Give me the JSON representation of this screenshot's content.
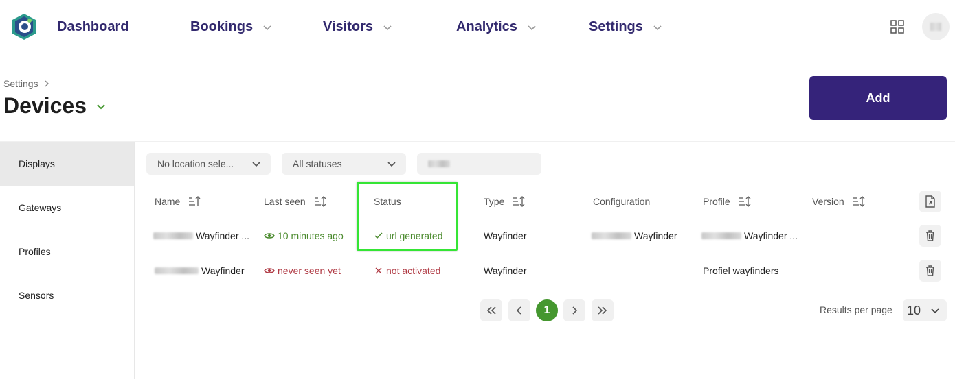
{
  "nav": {
    "dashboard": "Dashboard",
    "bookings": "Bookings",
    "visitors": "Visitors",
    "analytics": "Analytics",
    "settings": "Settings"
  },
  "header": {
    "breadcrumb": "Settings",
    "title": "Devices",
    "add_label": "Add"
  },
  "sidebar": {
    "items": [
      {
        "label": "Displays",
        "active": true
      },
      {
        "label": "Gateways"
      },
      {
        "label": "Profiles"
      },
      {
        "label": "Sensors"
      }
    ]
  },
  "filters": {
    "location": "No location sele...",
    "status": "All statuses"
  },
  "table": {
    "headers": {
      "name": "Name",
      "last_seen": "Last seen",
      "status": "Status",
      "type": "Type",
      "configuration": "Configuration",
      "profile": "Profile",
      "version": "Version"
    },
    "rows": [
      {
        "name": "Wayfinder ...",
        "last_seen": "10 minutes ago",
        "status": "url generated",
        "type": "Wayfinder",
        "configuration": "Wayfinder",
        "profile": "Wayfinder ...",
        "version": ""
      },
      {
        "name": "Wayfinder",
        "last_seen": "never seen yet",
        "status": "not activated",
        "type": "Wayfinder",
        "configuration": "",
        "profile": "Profiel wayfinders",
        "version": ""
      }
    ]
  },
  "pagination": {
    "current_page": "1",
    "results_label": "Results per page",
    "per_page": "10"
  },
  "colors": {
    "brand": "#35237a",
    "nav_text": "#32296e",
    "success": "#4a8a2d",
    "error": "#b03a44",
    "page_active": "#45972f",
    "highlight": "#35e535"
  }
}
